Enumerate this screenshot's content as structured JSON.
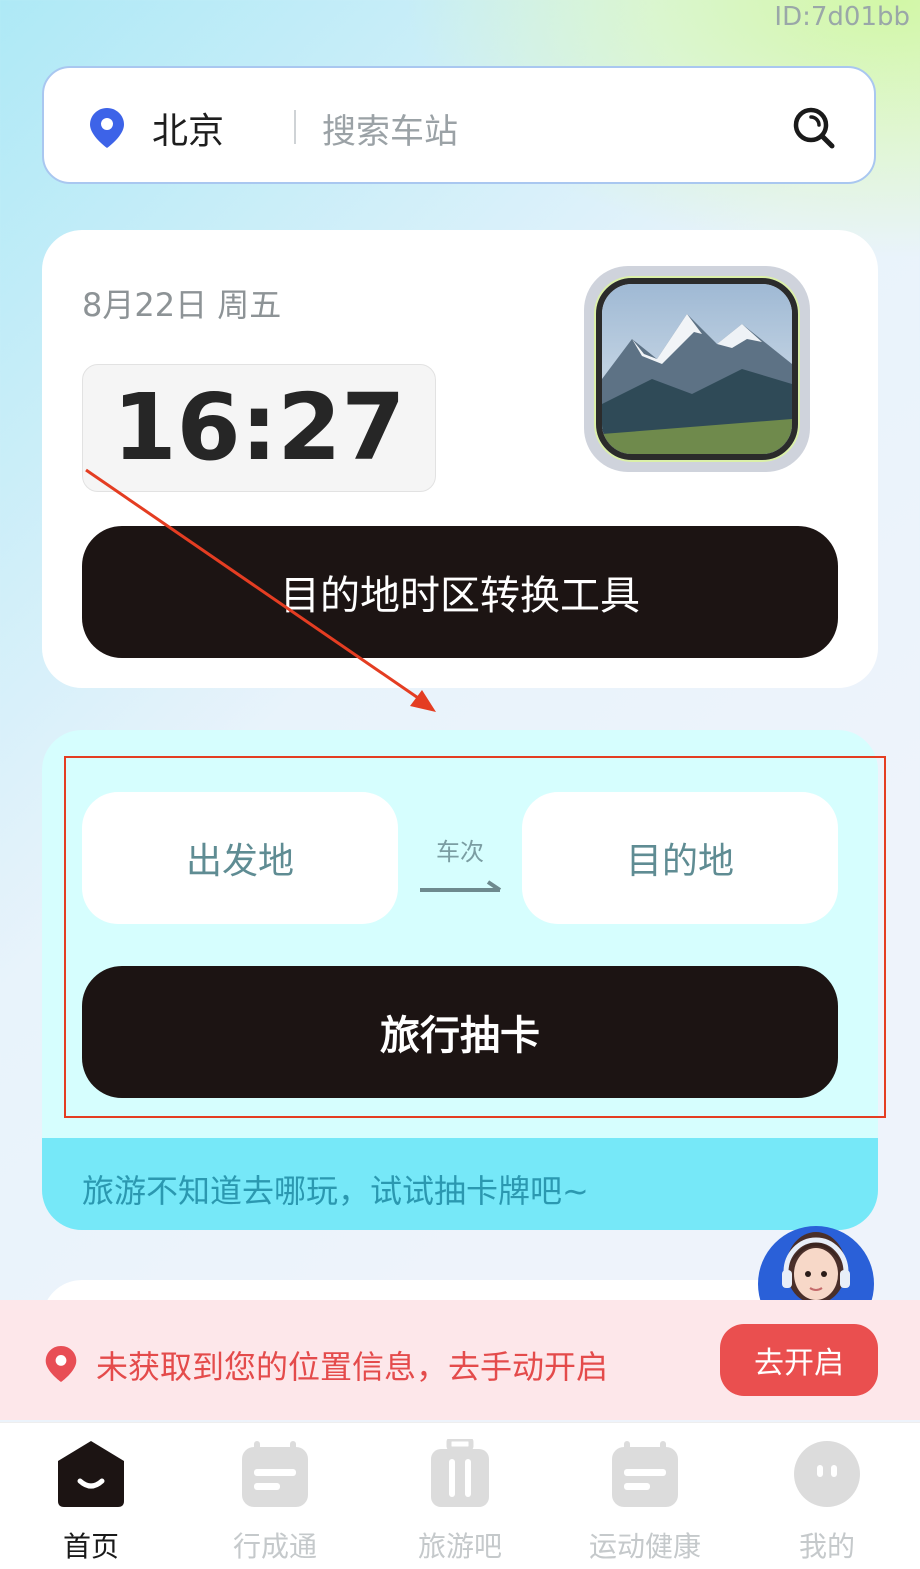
{
  "watermark": "ID:7d01bb",
  "search": {
    "city": "北京",
    "placeholder": "搜索车站"
  },
  "time_card": {
    "date": "8月22日 周五",
    "time": "16:27",
    "timezone_button": "目的地时区转换工具"
  },
  "travel_card": {
    "from": "出发地",
    "train_label": "车次",
    "to": "目的地",
    "draw_button": "旅行抽卡",
    "tip": "旅游不知道去哪玩，试试抽卡牌吧~"
  },
  "location_banner": {
    "message": "未获取到您的位置信息，去手动开启",
    "button": "去开启",
    "color": "#ea4f4f"
  },
  "tabs": [
    {
      "label": "首页",
      "icon": "home-icon",
      "active": true
    },
    {
      "label": "行成通",
      "icon": "calendar-icon",
      "active": false
    },
    {
      "label": "旅游吧",
      "icon": "luggage-icon",
      "active": false
    },
    {
      "label": "运动健康",
      "icon": "calendar-icon",
      "active": false
    },
    {
      "label": "我的",
      "icon": "profile-icon",
      "active": false
    }
  ],
  "colors": {
    "primary_button": "#1c1413",
    "accent_card": "#d6fefe",
    "tip_band": "#76e8f8"
  }
}
